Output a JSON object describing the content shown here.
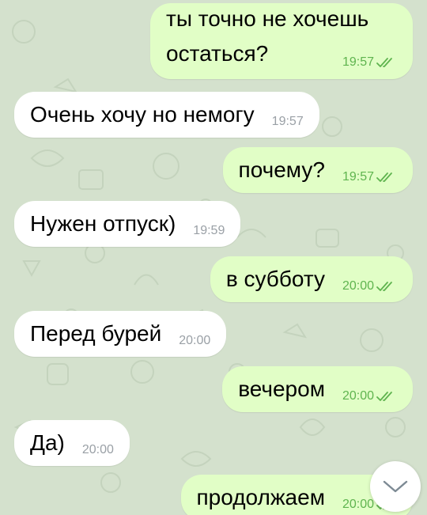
{
  "messages": [
    {
      "direction": "out",
      "text_line1": "ты точно не хочешь",
      "text_line2": "остаться?",
      "time": "19:57",
      "read": true
    },
    {
      "direction": "in",
      "text": "Очень хочу но немогу",
      "time": "19:57"
    },
    {
      "direction": "out",
      "text": "почему?",
      "time": "19:57",
      "read": true
    },
    {
      "direction": "in",
      "text": "Нужен отпуск)",
      "time": "19:59"
    },
    {
      "direction": "out",
      "text": "в субботу",
      "time": "20:00",
      "read": true
    },
    {
      "direction": "in",
      "text": "Перед бурей",
      "time": "20:00"
    },
    {
      "direction": "out",
      "text": "вечером",
      "time": "20:00",
      "read": true
    },
    {
      "direction": "in",
      "text": "Да)",
      "time": "20:00"
    },
    {
      "direction": "out",
      "text": "продолжаем",
      "time": "20:00",
      "read": true
    }
  ],
  "colors": {
    "wallpaper": "#d4e1cd",
    "incoming_bubble": "#ffffff",
    "outgoing_bubble": "#e1fec6",
    "outgoing_meta": "#5fb44f",
    "incoming_meta": "#9aa0a6"
  },
  "icons": {
    "read_receipt": "double-check-icon",
    "scroll_down": "chevron-down-icon"
  }
}
